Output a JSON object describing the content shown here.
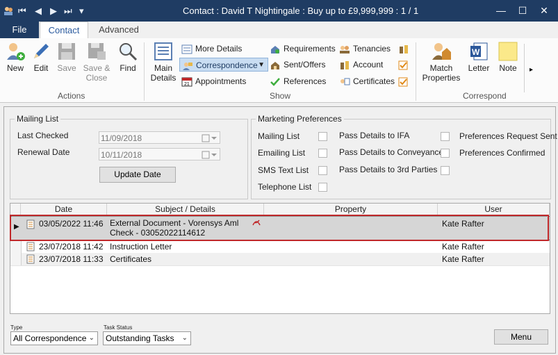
{
  "window": {
    "title": "Contact : David T Nightingale : Buy up to £9,999,999 : 1 / 1",
    "min_label": "—",
    "max_label": "☐",
    "close_label": "✕"
  },
  "tabs": {
    "file": "File",
    "contact": "Contact",
    "advanced": "Advanced"
  },
  "ribbon": {
    "actions": {
      "new": "New",
      "edit": "Edit",
      "save": "Save",
      "save_close_1": "Save &",
      "save_close_2": "Close",
      "find": "Find",
      "group": "Actions"
    },
    "show": {
      "main_details_1": "Main",
      "main_details_2": "Details",
      "more_details": "More Details",
      "correspondence": "Correspondence",
      "appointments": "Appointments",
      "requirements": "Requirements",
      "sent_offers": "Sent/Offers",
      "references": "References",
      "tenancies": "Tenancies",
      "account": "Account",
      "certificates": "Certificates",
      "group": "Show"
    },
    "correspond": {
      "match_1": "Match",
      "match_2": "Properties",
      "letter": "Letter",
      "note": "Note",
      "group": "Correspond"
    }
  },
  "mailing_list": {
    "title": "Mailing List",
    "last_checked_label": "Last Checked",
    "last_checked_value": "11/09/2018",
    "renewal_label": "Renewal Date",
    "renewal_value": "10/11/2018",
    "update_button": "Update Date"
  },
  "marketing": {
    "title": "Marketing Preferences",
    "col1": [
      "Mailing List",
      "Emailing List",
      "SMS Text List",
      "Telephone List"
    ],
    "col2": [
      "Pass Details to IFA",
      "Pass Details to Conveyancer",
      "Pass Details to 3rd Parties"
    ],
    "col3": [
      "Preferences Request Sent",
      "Preferences Confirmed"
    ]
  },
  "grid": {
    "headers": [
      "Date",
      "Subject / Details",
      "Property",
      "User"
    ],
    "rows": [
      {
        "date": "03/05/2022 11:46",
        "subject_1": "External Document - Vorensys Aml",
        "subject_2": "Check - 03052022114612",
        "user": "Kate Rafter"
      },
      {
        "date": "23/07/2018 11:42",
        "subject_1": "Instruction Letter",
        "subject_2": "",
        "user": "Kate Rafter"
      },
      {
        "date": "23/07/2018 11:33",
        "subject_1": "Certificates",
        "subject_2": "",
        "user": "Kate Rafter"
      }
    ]
  },
  "footer": {
    "type_label": "Type",
    "type_value": "All Correspondence",
    "task_label": "Task Status",
    "task_value": "Outstanding Tasks",
    "menu_button": "Menu"
  },
  "colors": {
    "titlebar": "#1f3c63",
    "accent": "#2a5a9e",
    "selection_outline": "#c0282a"
  }
}
